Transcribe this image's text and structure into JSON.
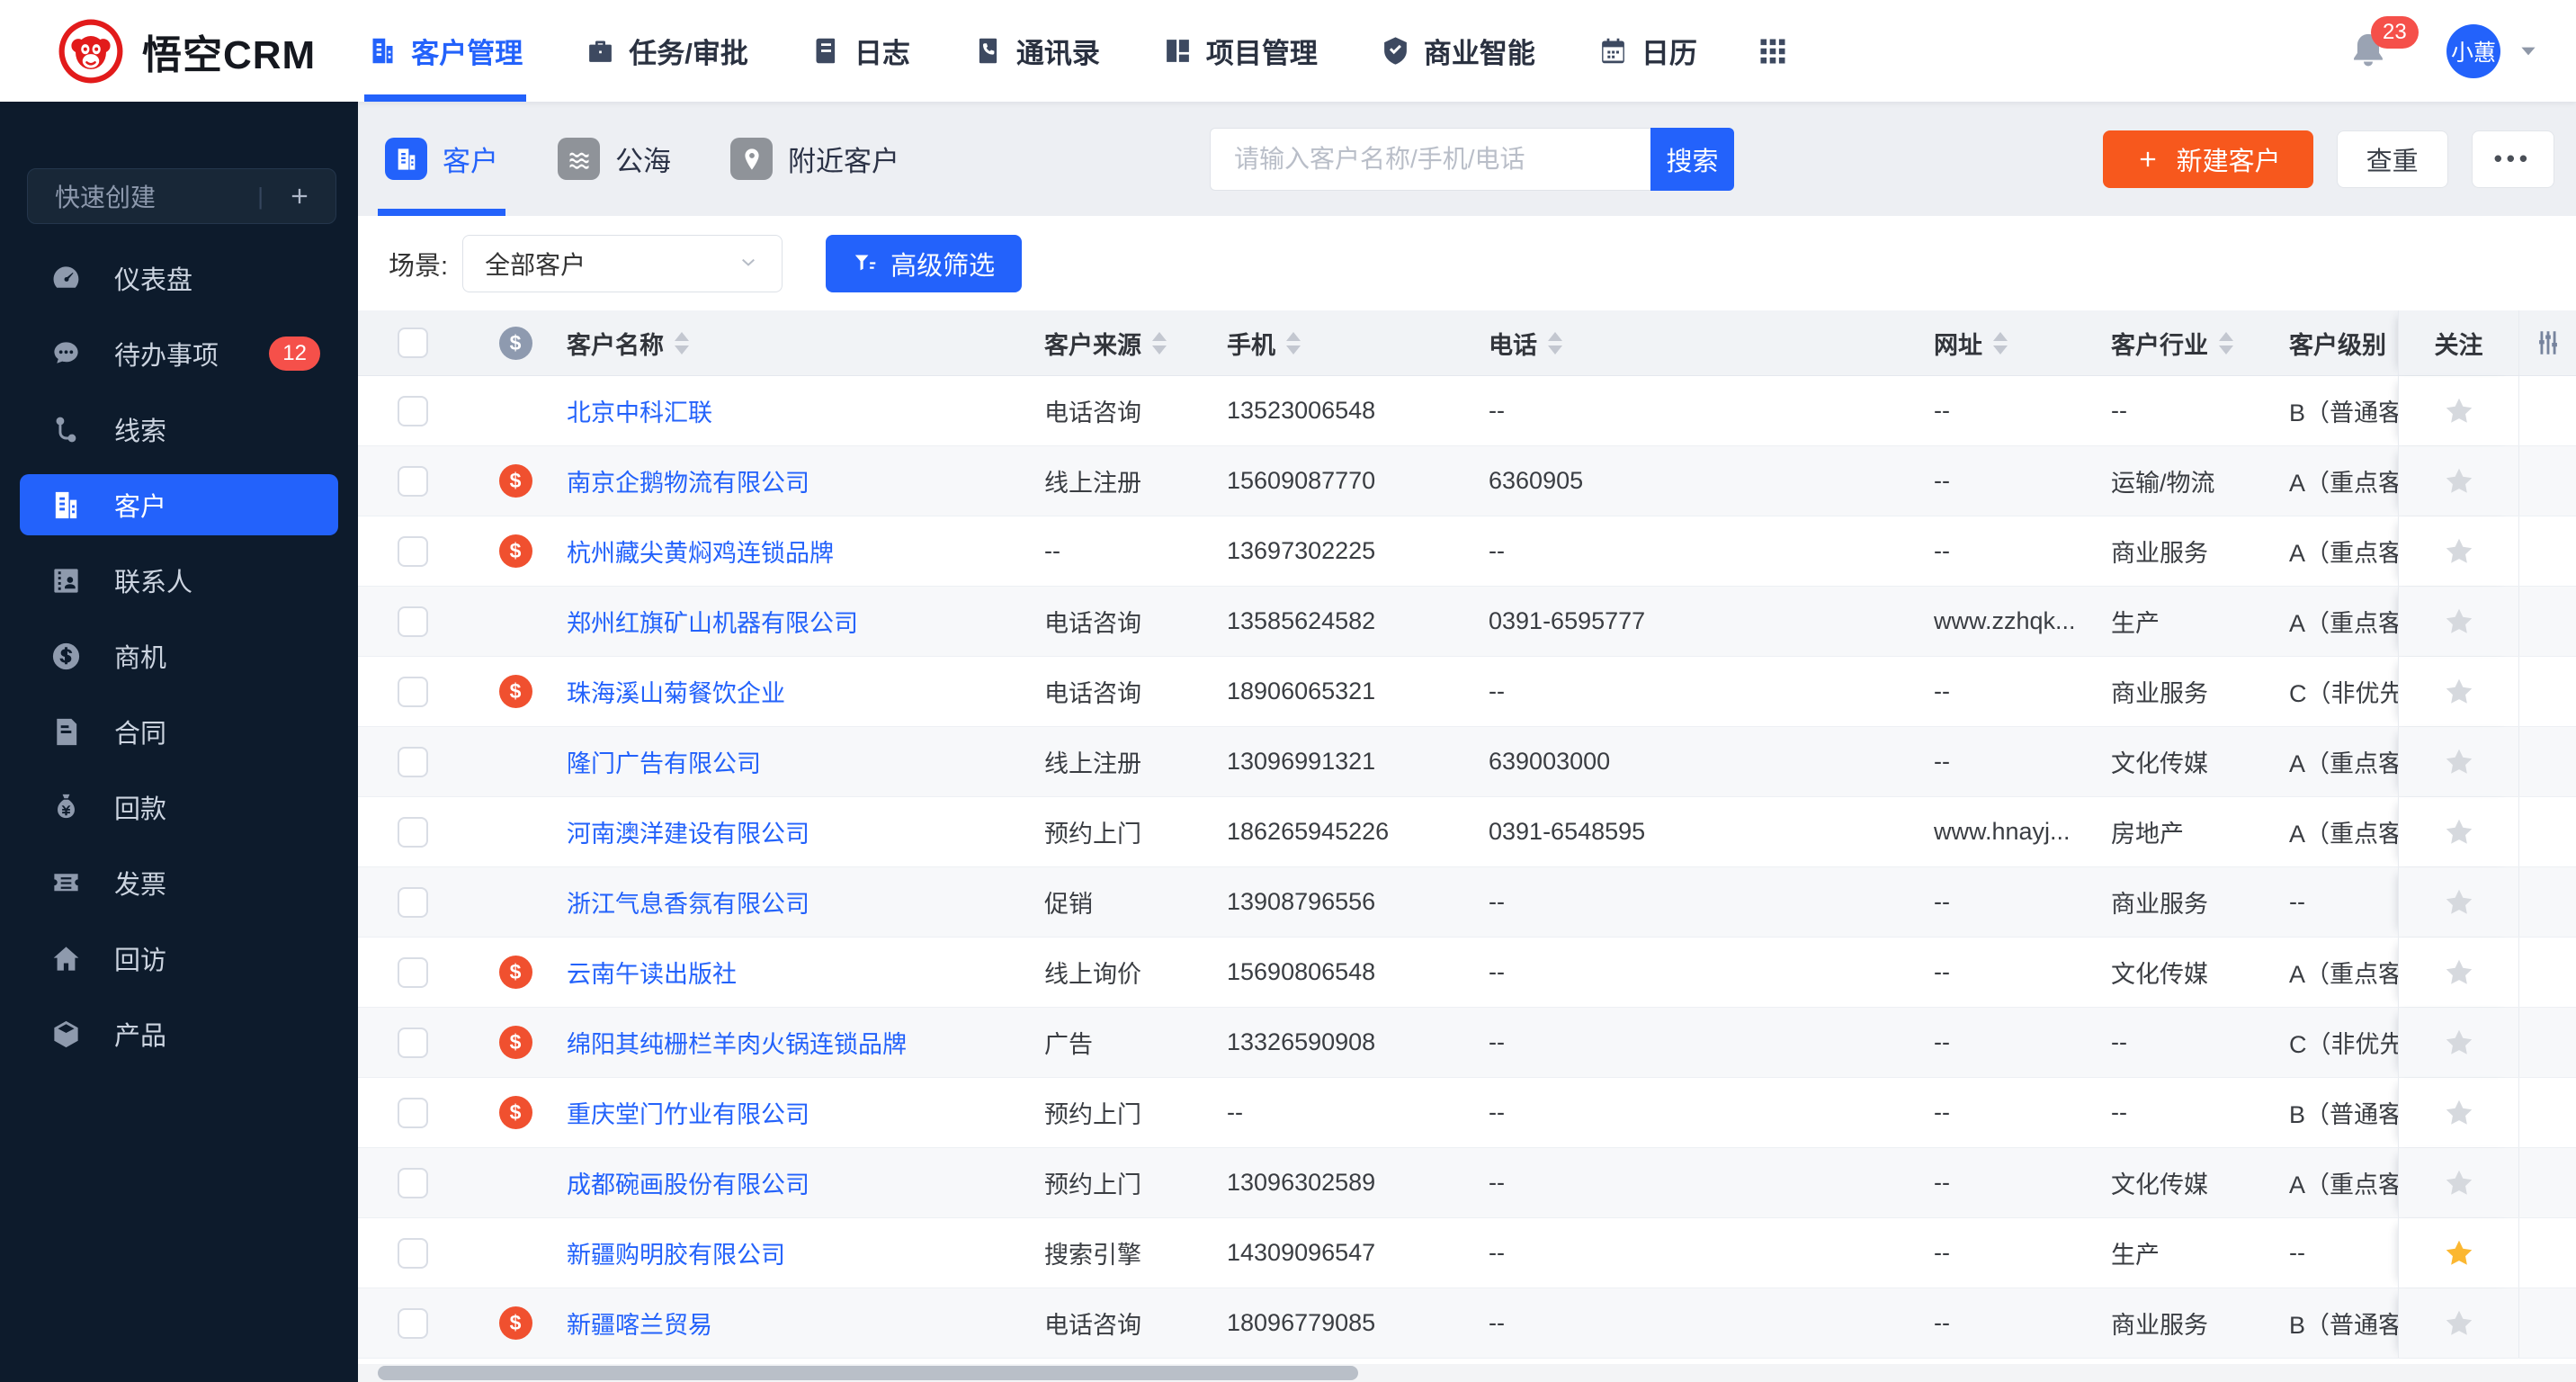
{
  "navbar": {
    "logo_text": "悟空CRM",
    "items": [
      {
        "label": "客户管理",
        "icon": "building",
        "active": true
      },
      {
        "label": "任务/审批",
        "icon": "briefcase",
        "active": false
      },
      {
        "label": "日志",
        "icon": "journal",
        "active": false
      },
      {
        "label": "通讯录",
        "icon": "phone-book",
        "active": false
      },
      {
        "label": "项目管理",
        "icon": "layout",
        "active": false
      },
      {
        "label": "商业智能",
        "icon": "shield-check",
        "active": false
      },
      {
        "label": "日历",
        "icon": "calendar",
        "active": false
      }
    ],
    "notifications_badge": "23",
    "user_name": "小蕙"
  },
  "sidebar": {
    "quick_create": "快速创建",
    "items": [
      {
        "label": "仪表盘",
        "icon": "gauge",
        "active": false
      },
      {
        "label": "待办事项",
        "icon": "chat",
        "badge": "12",
        "active": false
      },
      {
        "label": "线索",
        "icon": "route",
        "active": false
      },
      {
        "label": "客户",
        "icon": "building",
        "active": true
      },
      {
        "label": "联系人",
        "icon": "contact-card",
        "active": false
      },
      {
        "label": "商机",
        "icon": "coin-dollar",
        "active": false
      },
      {
        "label": "合同",
        "icon": "doc-star",
        "active": false
      },
      {
        "label": "回款",
        "icon": "money-bag",
        "active": false
      },
      {
        "label": "发票",
        "icon": "ticket",
        "active": false
      },
      {
        "label": "回访",
        "icon": "house",
        "active": false
      },
      {
        "label": "产品",
        "icon": "cube",
        "active": false
      }
    ]
  },
  "toolbar": {
    "tabs": [
      {
        "label": "客户",
        "icon": "building",
        "active": true
      },
      {
        "label": "公海",
        "icon": "waves",
        "active": false
      },
      {
        "label": "附近客户",
        "icon": "map-pin",
        "active": false
      }
    ],
    "search_placeholder": "请输入客户名称/手机/电话",
    "search_button": "搜索",
    "create_label": "新建客户",
    "dedupe_label": "查重",
    "more_label": "•••"
  },
  "filter": {
    "label": "场景:",
    "selected": "全部客户",
    "advanced_label": "高级筛选"
  },
  "table": {
    "columns": [
      {
        "key": "name",
        "label": "客户名称",
        "sortable": true
      },
      {
        "key": "source",
        "label": "客户来源",
        "sortable": true
      },
      {
        "key": "mobile",
        "label": "手机",
        "sortable": true
      },
      {
        "key": "phone",
        "label": "电话",
        "sortable": true
      },
      {
        "key": "website",
        "label": "网址",
        "sortable": true
      },
      {
        "key": "industry",
        "label": "客户行业",
        "sortable": true
      },
      {
        "key": "level",
        "label": "客户级别",
        "sortable": false
      },
      {
        "key": "star",
        "label": "关注",
        "sortable": false
      }
    ],
    "rows": [
      {
        "name": "北京中科汇联",
        "deal": false,
        "source": "电话咨询",
        "mobile": "13523006548",
        "phone": "--",
        "website": "--",
        "industry": "--",
        "level": "B（普通客",
        "starred": false
      },
      {
        "name": "南京企鹅物流有限公司",
        "deal": true,
        "source": "线上注册",
        "mobile": "15609087770",
        "phone": "6360905",
        "website": "--",
        "industry": "运输/物流",
        "level": "A（重点客",
        "starred": false
      },
      {
        "name": "杭州藏尖黄焖鸡连锁品牌",
        "deal": true,
        "source": "--",
        "mobile": "13697302225",
        "phone": "--",
        "website": "--",
        "industry": "商业服务",
        "level": "A（重点客",
        "starred": false
      },
      {
        "name": "郑州红旗矿山机器有限公司",
        "deal": false,
        "source": "电话咨询",
        "mobile": "13585624582",
        "phone": "0391-6595777",
        "website": "www.zzhqk...",
        "industry": "生产",
        "level": "A（重点客",
        "starred": false
      },
      {
        "name": "珠海溪山菊餐饮企业",
        "deal": true,
        "source": "电话咨询",
        "mobile": "18906065321",
        "phone": "--",
        "website": "--",
        "industry": "商业服务",
        "level": "C（非优先",
        "starred": false
      },
      {
        "name": "隆门广告有限公司",
        "deal": false,
        "source": "线上注册",
        "mobile": "13096991321",
        "phone": "639003000",
        "website": "--",
        "industry": "文化传媒",
        "level": "A（重点客",
        "starred": false
      },
      {
        "name": "河南澳洋建设有限公司",
        "deal": false,
        "source": "预约上门",
        "mobile": "186265945226",
        "phone": "0391-6548595",
        "website": "www.hnayj...",
        "industry": "房地产",
        "level": "A（重点客",
        "starred": false
      },
      {
        "name": "浙江气息香氛有限公司",
        "deal": false,
        "source": "促销",
        "mobile": "13908796556",
        "phone": "--",
        "website": "--",
        "industry": "商业服务",
        "level": "--",
        "starred": false
      },
      {
        "name": "云南午读出版社",
        "deal": true,
        "source": "线上询价",
        "mobile": "15690806548",
        "phone": "--",
        "website": "--",
        "industry": "文化传媒",
        "level": "A（重点客",
        "starred": false
      },
      {
        "name": "绵阳其纯栅栏羊肉火锅连锁品牌",
        "deal": true,
        "source": "广告",
        "mobile": "13326590908",
        "phone": "--",
        "website": "--",
        "industry": "--",
        "level": "C（非优先",
        "starred": false
      },
      {
        "name": "重庆堂门竹业有限公司",
        "deal": true,
        "source": "预约上门",
        "mobile": "--",
        "phone": "--",
        "website": "--",
        "industry": "--",
        "level": "B（普通客",
        "starred": false
      },
      {
        "name": "成都碗画股份有限公司",
        "deal": false,
        "source": "预约上门",
        "mobile": "13096302589",
        "phone": "--",
        "website": "--",
        "industry": "文化传媒",
        "level": "A（重点客",
        "starred": false
      },
      {
        "name": "新疆购明胶有限公司",
        "deal": false,
        "source": "搜索引擎",
        "mobile": "14309096547",
        "phone": "--",
        "website": "--",
        "industry": "生产",
        "level": "--",
        "starred": true
      },
      {
        "name": "新疆喀兰贸易",
        "deal": true,
        "source": "电话咨询",
        "mobile": "18096779085",
        "phone": "--",
        "website": "--",
        "industry": "商业服务",
        "level": "B（普通客",
        "starred": false
      }
    ]
  },
  "colors": {
    "accent_blue": "#2362fb",
    "brand_red": "#e21b1b",
    "create_orange": "#f7581d",
    "badge_red": "#f5504a",
    "deal_red": "#f0502f",
    "star_gold": "#fbb731",
    "star_gray": "#d6d9de"
  }
}
